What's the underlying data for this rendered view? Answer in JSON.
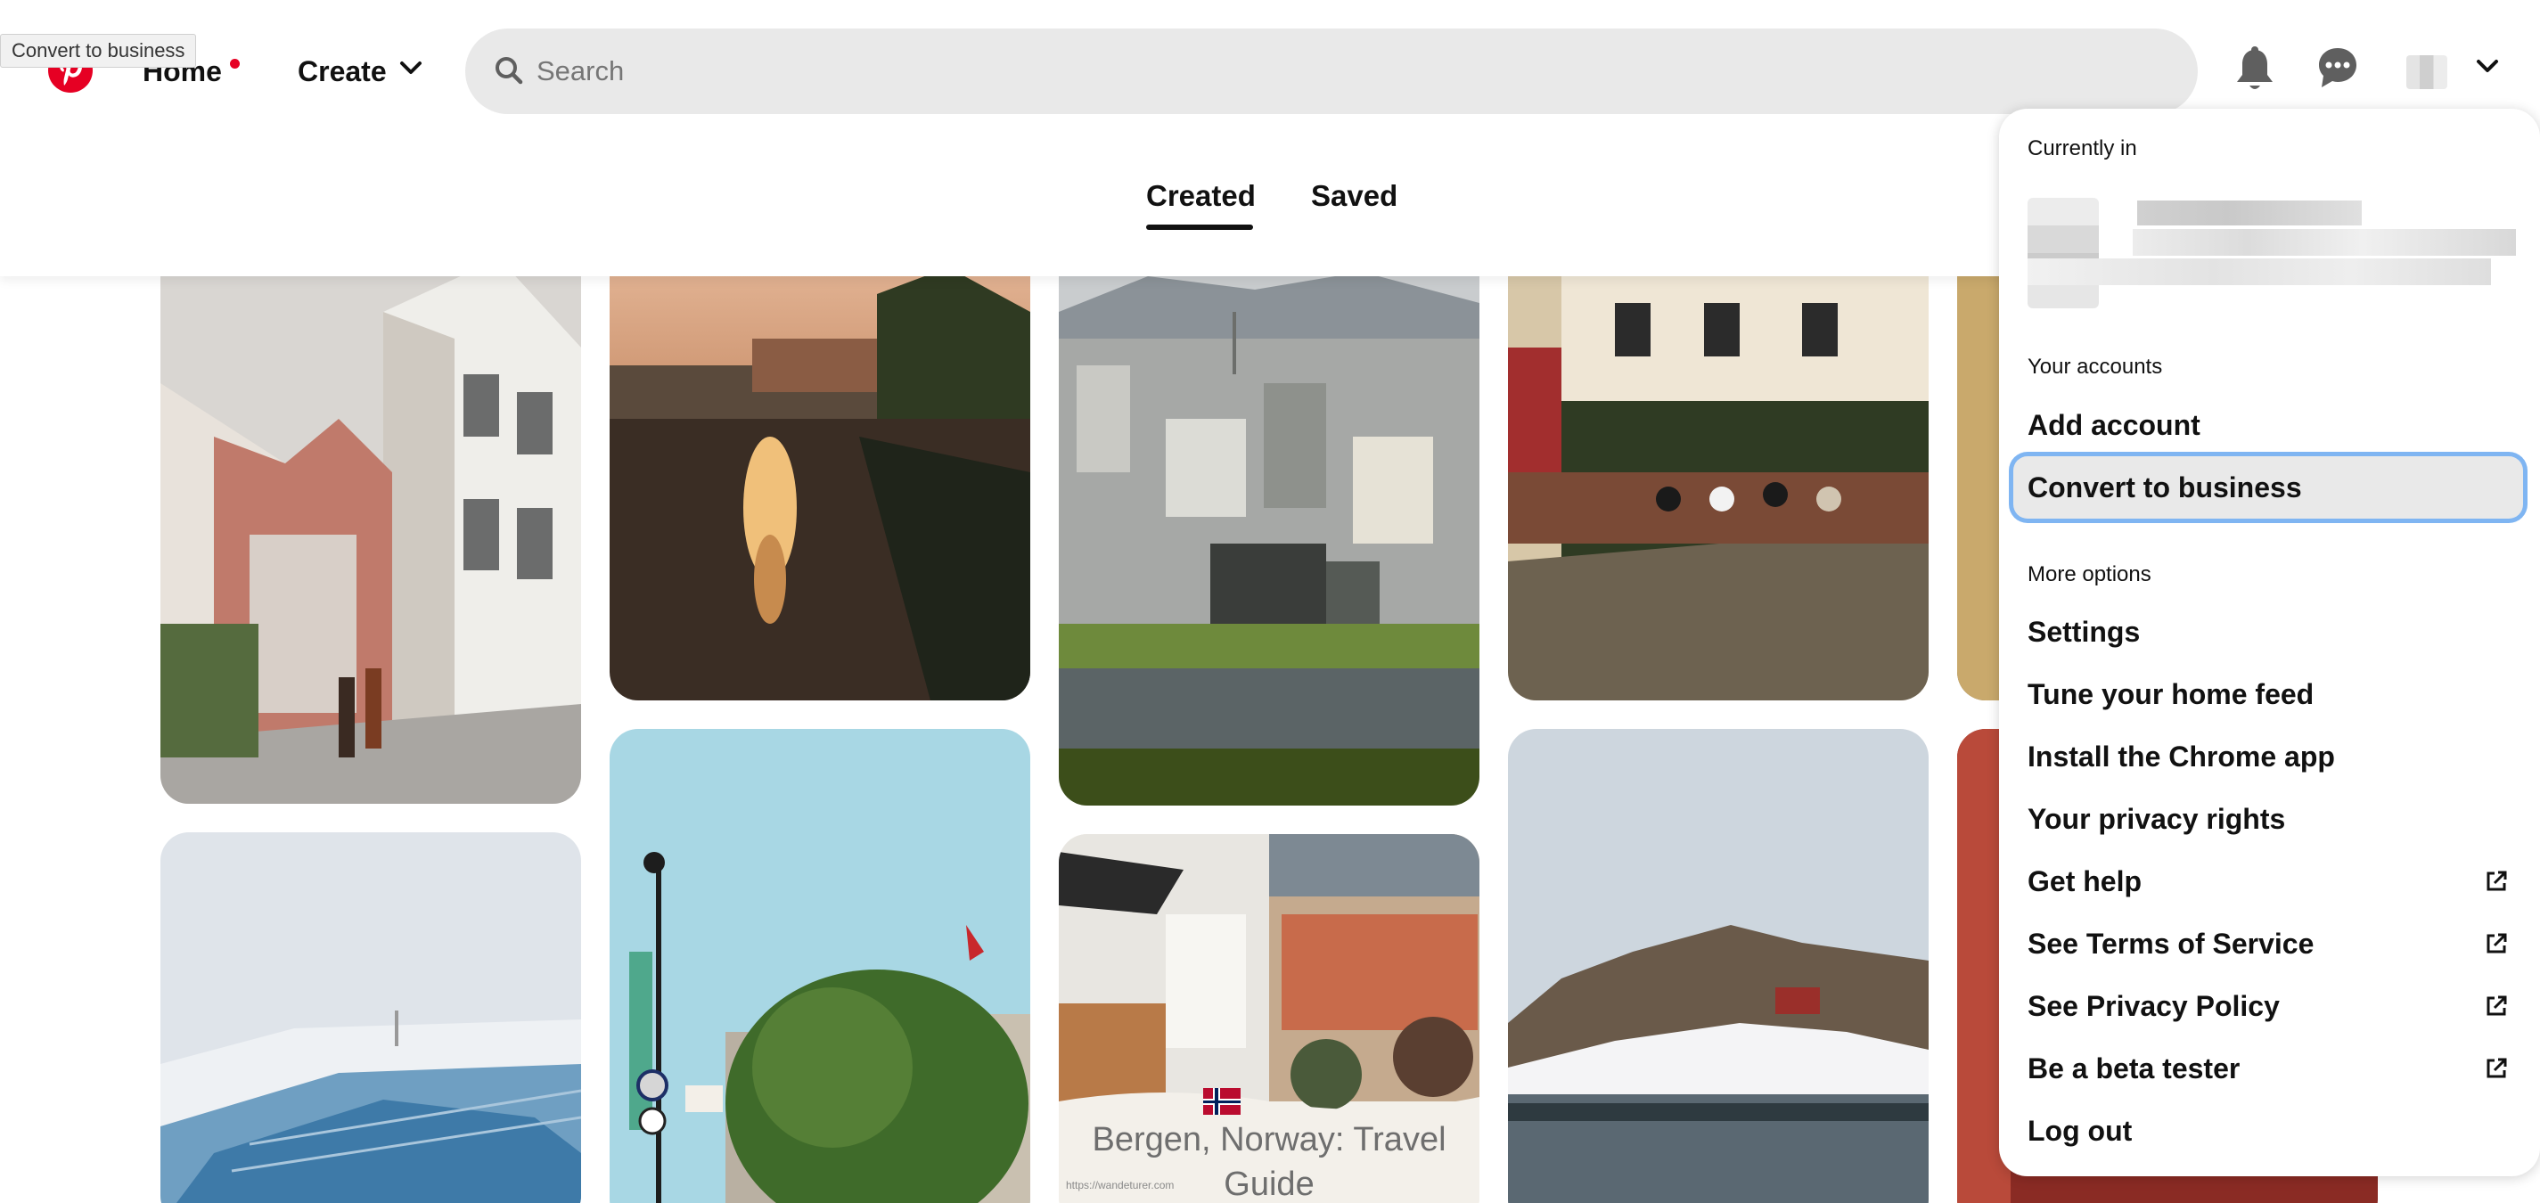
{
  "tooltip": "Convert to business",
  "nav": {
    "home": "Home",
    "create": "Create"
  },
  "search": {
    "placeholder": "Search",
    "value": ""
  },
  "tabs": [
    {
      "label": "Created",
      "selected": true
    },
    {
      "label": "Saved",
      "selected": false
    }
  ],
  "pins": [
    {
      "caption": ""
    },
    {
      "caption": ""
    },
    {
      "caption": ""
    },
    {
      "caption": ""
    },
    {
      "caption": "Bergen, Norway: Travel Guide"
    }
  ],
  "menu": {
    "currently_in": "Currently in",
    "your_accounts": "Your accounts",
    "add_account": "Add account",
    "convert_to_business": "Convert to business",
    "more_options": "More options",
    "items": [
      {
        "label": "Settings",
        "external": false
      },
      {
        "label": "Tune your home feed",
        "external": false
      },
      {
        "label": "Install the Chrome app",
        "external": false
      },
      {
        "label": "Your privacy rights",
        "external": false
      },
      {
        "label": "Get help",
        "external": true
      },
      {
        "label": "See Terms of Service",
        "external": true
      },
      {
        "label": "See Privacy Policy",
        "external": true
      },
      {
        "label": "Be a beta tester",
        "external": true
      },
      {
        "label": "Log out",
        "external": false
      }
    ]
  },
  "colors": {
    "brand": "#e60023",
    "focus_ring": "#7fb5f2",
    "search_bg": "#e9e9e9"
  },
  "icons": [
    "pinterest-logo-icon",
    "chevron-down-icon",
    "search-icon",
    "bell-icon",
    "chat-icon",
    "external-link-icon"
  ]
}
